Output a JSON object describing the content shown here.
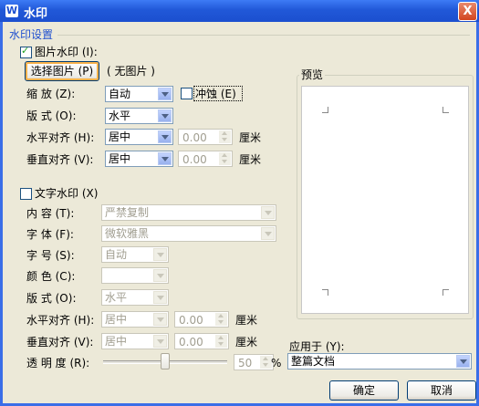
{
  "window": {
    "title": "水印",
    "close_glyph": "X",
    "app_icon_glyph": "W"
  },
  "settings_group": {
    "title": "水印设置"
  },
  "picture_watermark": {
    "checkbox_label": "图片水印 (I):",
    "checked": true,
    "select_button": "选择图片 (P)",
    "no_picture": "( 无图片 )",
    "scale_label": "缩    放 (Z):",
    "scale_value": "自动",
    "washout_label": "冲蚀 (E)",
    "layout_label": "版    式 (O):",
    "layout_value": "水平",
    "halign_label": "水平对齐 (H):",
    "halign_value": "居中",
    "halign_offset": "0.00",
    "valign_label": "垂直对齐 (V):",
    "valign_value": "居中",
    "valign_offset": "0.00",
    "unit": "厘米"
  },
  "text_watermark": {
    "checkbox_label": "文字水印 (X)",
    "checked": false,
    "content_label": "内    容 (T):",
    "content_value": "严禁复制",
    "font_label": "字    体 (F):",
    "font_value": "微软雅黑",
    "size_label": "字    号 (S):",
    "size_value": "自动",
    "color_label": "颜    色 (C):",
    "color_value": "",
    "layout_label": "版    式 (O):",
    "layout_value": "水平",
    "halign_label": "水平对齐 (H):",
    "halign_value": "居中",
    "halign_offset": "0.00",
    "valign_label": "垂直对齐 (V):",
    "valign_value": "居中",
    "valign_offset": "0.00",
    "unit": "厘米",
    "transparency_label": "透 明 度 (R):",
    "transparency_value": "50",
    "transparency_unit": "%"
  },
  "preview": {
    "title": "预览"
  },
  "apply_to": {
    "label": "应用于 (Y):",
    "value": "整篇文档"
  },
  "buttons": {
    "ok": "确定",
    "cancel": "取消"
  },
  "colors": {
    "titlebar": "#2158d8",
    "dialog_bg": "#ece9d8",
    "group_title": "#1f4fcf",
    "disabled_text": "#a19e90"
  }
}
